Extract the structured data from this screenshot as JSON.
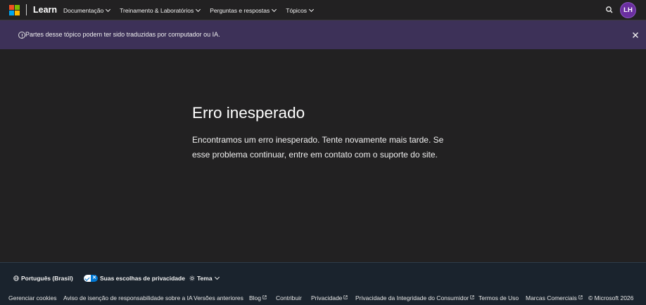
{
  "header": {
    "brand": "Learn",
    "nav": [
      {
        "label": "Documentação"
      },
      {
        "label": "Treinamento & Laboratórios"
      },
      {
        "label": "Perguntas e respostas"
      },
      {
        "label": "Tópicos"
      }
    ],
    "avatar_initials": "LH",
    "icons": {
      "logo": "microsoft-logo",
      "search": "search-icon"
    },
    "colors": {
      "avatar": "#6b2fa0",
      "background": "#222122"
    }
  },
  "banner": {
    "text": "Partes desse tópico podem ter sido traduzidas por computador ou IA.",
    "icons": {
      "info": "info-icon",
      "close": "close-icon"
    },
    "color": "#3d3158"
  },
  "main": {
    "title": "Erro inesperado",
    "message": "Encontramos um erro inesperado. Tente novamente mais tarde. Se esse problema continuar, entre em contato com o suporte do site."
  },
  "footer": {
    "language": "Português (Brasil)",
    "privacy_choices": "Suas escolhas de privacidade",
    "theme": "Tema",
    "links": [
      {
        "label": "Gerenciar cookies",
        "external": false
      },
      {
        "label": "Aviso de isenção de responsabilidade sobre a IA",
        "external": false
      },
      {
        "label": "Versões anteriores",
        "external": false
      },
      {
        "label": "Blog",
        "external": true
      },
      {
        "label": "Contribuir",
        "external": false
      },
      {
        "label": "Privacidade",
        "external": true
      },
      {
        "label": "Privacidade da Integridade do Consumidor",
        "external": true
      },
      {
        "label": "Termos de Uso",
        "external": false
      },
      {
        "label": "Marcas Comerciais",
        "external": true
      }
    ],
    "copyright": "© Microsoft 2026",
    "color": "#1a232d"
  }
}
